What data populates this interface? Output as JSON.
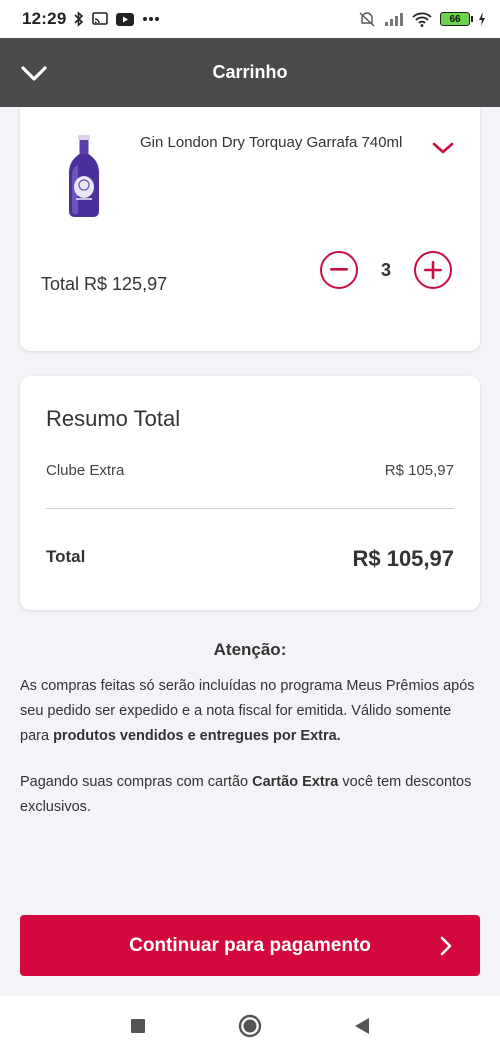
{
  "status_bar": {
    "time": "12:29",
    "battery": "66"
  },
  "header": {
    "title": "Carrinho"
  },
  "product": {
    "name": "Gin London Dry Torquay Garrafa 740ml",
    "total": "Total R$ 125,97",
    "quantity": "3"
  },
  "summary": {
    "title": "Resumo Total",
    "row_label": "Clube Extra",
    "row_value": "R$ 105,97",
    "total_label": "Total",
    "total_value": "R$ 105,97"
  },
  "attention": {
    "title": "Atenção:",
    "p1_text": "As compras feitas só serão incluídas no programa Meus Prêmios após seu pedido ser expedido e a nota fiscal for emitida. Válido somente para ",
    "p1_bold": "produtos vendidos e entregues por Extra.",
    "p2_before": "Pagando suas compras com cartão ",
    "p2_bold": "Cartão Extra",
    "p2_after": " você tem descontos exclusivos."
  },
  "cta": {
    "label": "Continuar para pagamento"
  },
  "colors": {
    "accent": "#d3093e",
    "header_bg": "#4b4b4b",
    "page_bg": "#f3f4f7"
  },
  "icons": {
    "back": "chevron-down-icon",
    "expand": "chevron-down-icon",
    "minus": "minus-circle-icon",
    "plus": "plus-circle-icon",
    "cta_arrow": "chevron-right-icon",
    "nav_recents": "square-icon",
    "nav_home": "circle-icon",
    "nav_back": "triangle-back-icon"
  }
}
